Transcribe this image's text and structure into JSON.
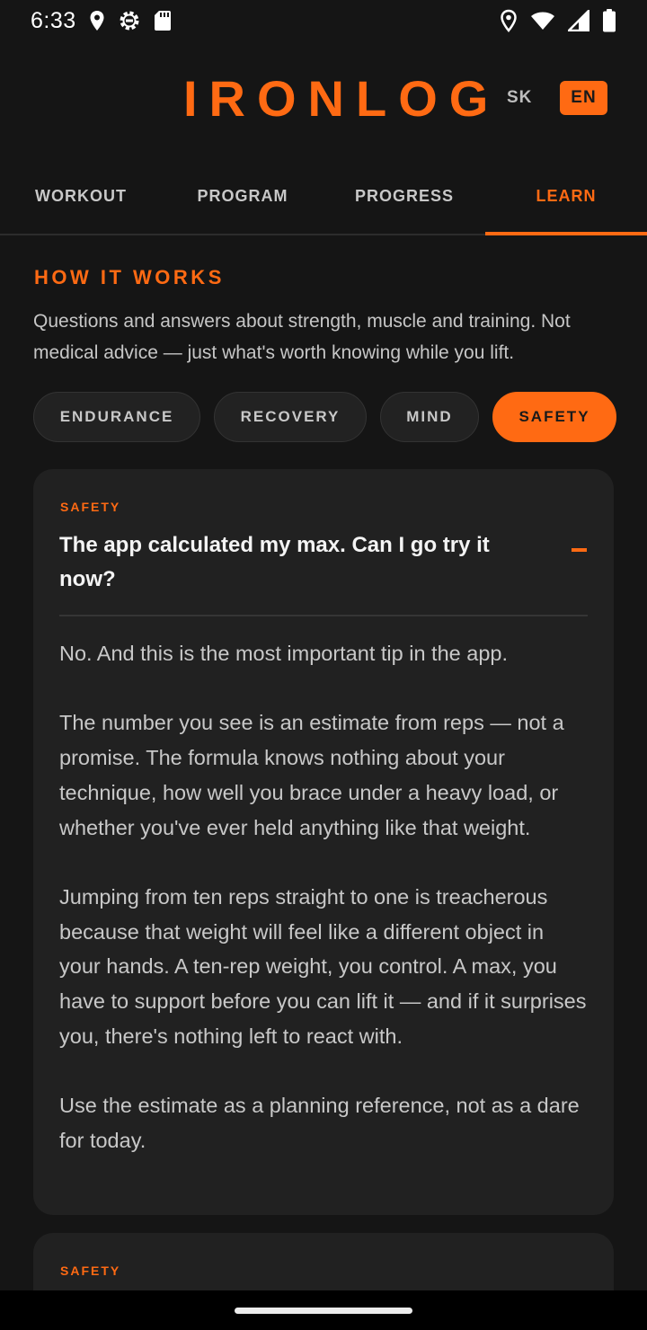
{
  "status_bar": {
    "time": "6:33",
    "left_icons": [
      "location-icon",
      "settings-gear-icon",
      "sd-card-icon"
    ],
    "right_icons": [
      "location-icon",
      "wifi-icon",
      "cell-signal-icon",
      "battery-icon"
    ]
  },
  "header": {
    "brand": "IRONLOG",
    "languages": [
      {
        "code": "SK",
        "selected": false
      },
      {
        "code": "EN",
        "selected": true
      }
    ]
  },
  "tabs": [
    {
      "label": "WORKOUT",
      "active": false
    },
    {
      "label": "PROGRAM",
      "active": false
    },
    {
      "label": "PROGRESS",
      "active": false
    },
    {
      "label": "LEARN",
      "active": true
    }
  ],
  "section": {
    "title": "HOW IT WORKS",
    "description": "Questions and answers about strength, muscle and training. Not medical advice — just what's worth knowing while you lift."
  },
  "filters": [
    {
      "label": "ENDURANCE",
      "active": false
    },
    {
      "label": "RECOVERY",
      "active": false
    },
    {
      "label": "MIND",
      "active": false
    },
    {
      "label": "SAFETY",
      "active": true
    }
  ],
  "cards": [
    {
      "tag": "SAFETY",
      "question": "The app calculated my max. Can I go try it now?",
      "expanded": true,
      "answer": [
        "No. And this is the most important tip in the app.",
        "The number you see is an estimate from reps — not a promise. The formula knows nothing about your technique, how well you brace under a heavy load, or whether you've ever held anything like that weight.",
        "Jumping from ten reps straight to one is treacherous because that weight will feel like a different object in your hands. A ten-rep weight, you control. A max, you have to support before you can lift it — and if it surprises you, there's nothing left to react with.",
        "Use the estimate as a planning reference, not as a dare for today."
      ]
    },
    {
      "tag": "SAFETY",
      "expanded": false
    }
  ],
  "colors": {
    "accent": "#ff6a13",
    "background": "#151515",
    "card": "#212121"
  }
}
